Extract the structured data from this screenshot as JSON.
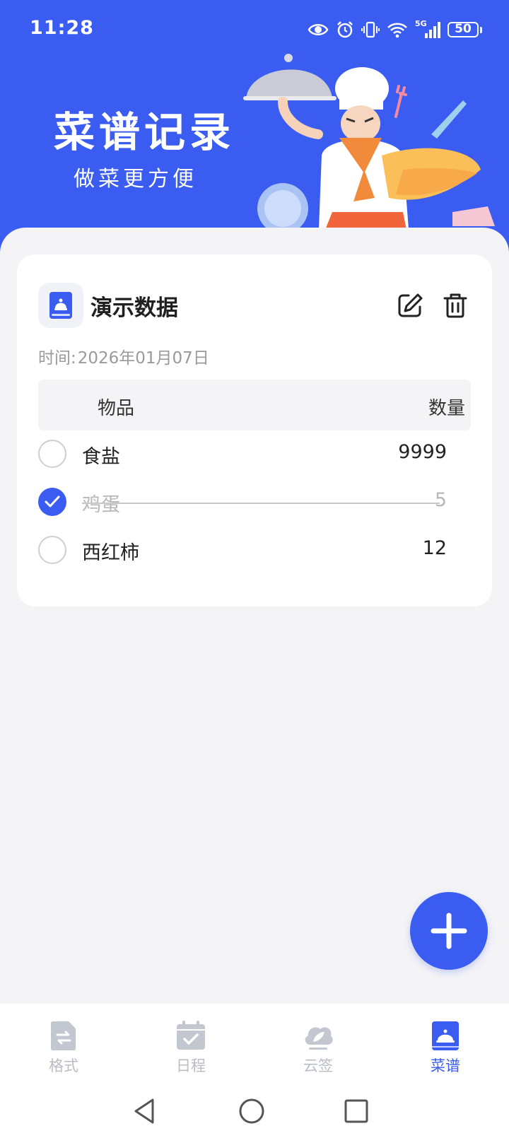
{
  "status_bar": {
    "time": "11:28",
    "network": "5G",
    "battery": "50"
  },
  "hero": {
    "title": "菜谱记录",
    "subtitle": "做菜更方便",
    "background_color": "#3a5cf0"
  },
  "card": {
    "icon": "recipe-book-icon",
    "title": "演示数据",
    "date_label": "时间:",
    "date_value": "2026年01月07日",
    "header_item": "物品",
    "header_qty": "数量",
    "items": [
      {
        "name": "食盐",
        "qty": "9999",
        "checked": false
      },
      {
        "name": "鸡蛋",
        "qty": "5",
        "checked": true
      },
      {
        "name": "西红柿",
        "qty": "12",
        "checked": false
      }
    ]
  },
  "tabs": [
    {
      "label": "格式",
      "icon": "format-doc-icon",
      "active": false
    },
    {
      "label": "日程",
      "icon": "calendar-check-icon",
      "active": false
    },
    {
      "label": "云签",
      "icon": "cloud-leaf-icon",
      "active": false
    },
    {
      "label": "菜谱",
      "icon": "recipe-book-icon",
      "active": true
    }
  ],
  "colors": {
    "accent": "#3a5cf0",
    "inactive_tab": "#b9bcc4",
    "background": "#f4f4f6"
  }
}
